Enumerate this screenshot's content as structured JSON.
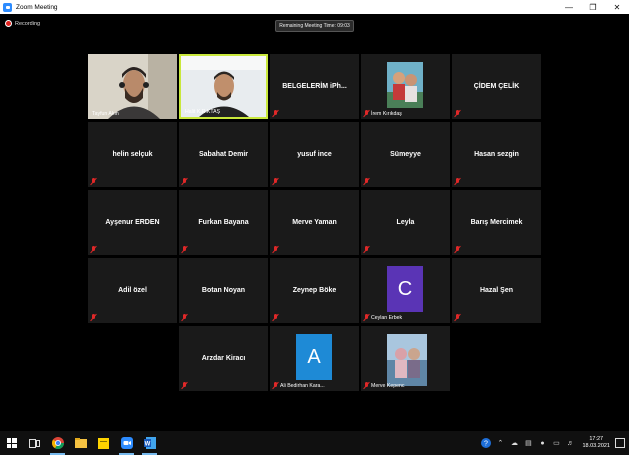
{
  "window": {
    "title": "Zoom Meeting"
  },
  "recording": {
    "label": "Recording"
  },
  "timer": {
    "label": "Remaining Meeting Time: 09:03"
  },
  "participants": [
    {
      "name": "Tayfun Akın",
      "display": "video"
    },
    {
      "name": "Halit K.R.KTAŞ",
      "display": "video",
      "active": true
    },
    {
      "name": "BELGELERİM iPh...",
      "display": "name"
    },
    {
      "name": "İrem Kırıkdaş",
      "display": "photo"
    },
    {
      "name": "ÇİDEM ÇELİK",
      "display": "name"
    },
    {
      "name": "helin selçuk",
      "display": "name"
    },
    {
      "name": "Sabahat Demir",
      "display": "name"
    },
    {
      "name": "yusuf ince",
      "display": "name"
    },
    {
      "name": "Sümeyye",
      "display": "name"
    },
    {
      "name": "Hasan sezgin",
      "display": "name"
    },
    {
      "name": "Ayşenur ERDEN",
      "display": "name"
    },
    {
      "name": "Furkan Bayana",
      "display": "name"
    },
    {
      "name": "Merve Yaman",
      "display": "name"
    },
    {
      "name": "Leyla",
      "display": "name"
    },
    {
      "name": "Barış Mercimek",
      "display": "name"
    },
    {
      "name": "Adil özel",
      "display": "name"
    },
    {
      "name": "Botan Noyan",
      "display": "name"
    },
    {
      "name": "Zeynep Böke",
      "display": "name"
    },
    {
      "name": "Ceylan Erbek",
      "display": "avatar",
      "letter": "C",
      "color": "#5a34b5"
    },
    {
      "name": "Hazal Şen",
      "display": "name"
    },
    {
      "name": "Arzdar Kiracı",
      "display": "name"
    },
    {
      "name": "Ali Bedirhan Kara...",
      "display": "avatar",
      "letter": "A",
      "color": "#1e8ad6"
    },
    {
      "name": "Merve Kepenc",
      "display": "photo"
    }
  ],
  "taskbar": {
    "apps": [
      "windows-start",
      "task-view",
      "chrome",
      "file-explorer",
      "sticky-notes",
      "zoom",
      "word"
    ],
    "clock": {
      "time": "17:27",
      "date": "18.03.2021"
    }
  }
}
